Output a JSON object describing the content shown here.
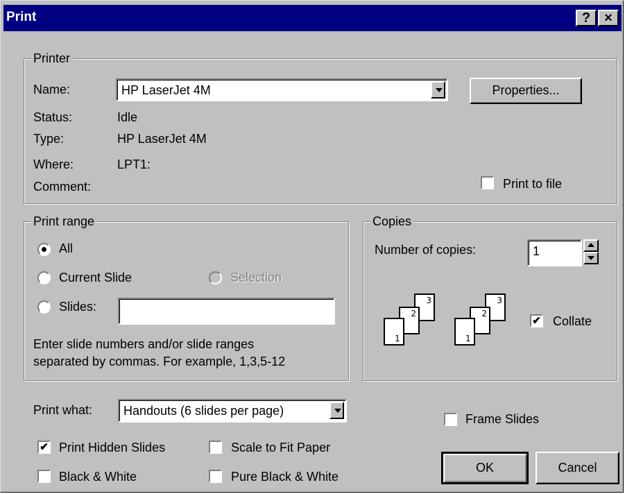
{
  "window": {
    "title": "Print",
    "help_glyph": "?",
    "close_glyph": "×"
  },
  "printer": {
    "group_label": "Printer",
    "name_label": "Name:",
    "name_value": "HP LaserJet 4M",
    "status_label": "Status:",
    "status_value": "Idle",
    "type_label": "Type:",
    "type_value": "HP LaserJet 4M",
    "where_label": "Where:",
    "where_value": "LPT1:",
    "comment_label": "Comment:",
    "properties_button": "Properties...",
    "print_to_file_label": "Print to file",
    "print_to_file_checked": false
  },
  "print_range": {
    "group_label": "Print range",
    "all_label": "All",
    "current_slide_label": "Current Slide",
    "selection_label": "Selection",
    "slides_label": "Slides:",
    "slides_value": "",
    "selected": "All",
    "hint_line1": "Enter slide numbers and/or slide ranges",
    "hint_line2": "separated by commas. For example, 1,3,5-12"
  },
  "copies": {
    "group_label": "Copies",
    "number_label": "Number of copies:",
    "number_value": "1",
    "collate_label": "Collate",
    "collate_checked": true,
    "page_numbers": [
      "1",
      "2",
      "3"
    ]
  },
  "print_what": {
    "label": "Print what:",
    "value": "Handouts (6 slides per page)"
  },
  "options": {
    "frame_slides_label": "Frame Slides",
    "frame_slides_checked": false,
    "print_hidden_label": "Print Hidden Slides",
    "print_hidden_checked": true,
    "scale_label": "Scale to Fit Paper",
    "scale_checked": false,
    "bw_label": "Black & White",
    "bw_checked": false,
    "pure_bw_label": "Pure Black & White",
    "pure_bw_checked": false
  },
  "buttons": {
    "ok": "OK",
    "cancel": "Cancel"
  },
  "check_glyph": "✔",
  "colors": {
    "titlebar": "#000080",
    "face": "#c0c0c0",
    "shadow": "#808080"
  }
}
